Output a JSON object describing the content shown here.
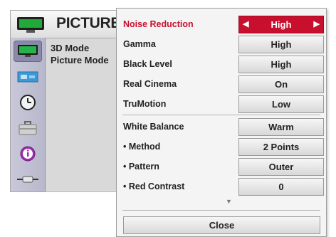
{
  "background_menu": {
    "title": "PICTURE",
    "items": [
      "3D Mode",
      "Picture Mode"
    ],
    "categories": [
      {
        "icon": "picture-icon",
        "selected": true
      },
      {
        "icon": "screen-icon",
        "selected": false
      },
      {
        "icon": "clock-icon",
        "selected": false
      },
      {
        "icon": "briefcase-icon",
        "selected": false
      },
      {
        "icon": "info-icon",
        "selected": false
      },
      {
        "icon": "input-connector-icon",
        "selected": false
      }
    ]
  },
  "options_popup": {
    "rows": [
      {
        "label": "Noise Reduction",
        "value": "High",
        "active": true
      },
      {
        "label": "Gamma",
        "value": "High"
      },
      {
        "label": "Black Level",
        "value": "High"
      },
      {
        "label": "Real Cinema",
        "value": "On"
      },
      {
        "label": "TruMotion",
        "value": "Low"
      },
      {
        "label": "White Balance",
        "value": "Warm"
      },
      {
        "label": "• Method",
        "value": "2 Points"
      },
      {
        "label": "• Pattern",
        "value": "Outer"
      },
      {
        "label": "• Red Contrast",
        "value": "0"
      }
    ],
    "close_label": "Close",
    "colors": {
      "accent": "#c8102e",
      "panel": "#f4f4f4"
    }
  }
}
